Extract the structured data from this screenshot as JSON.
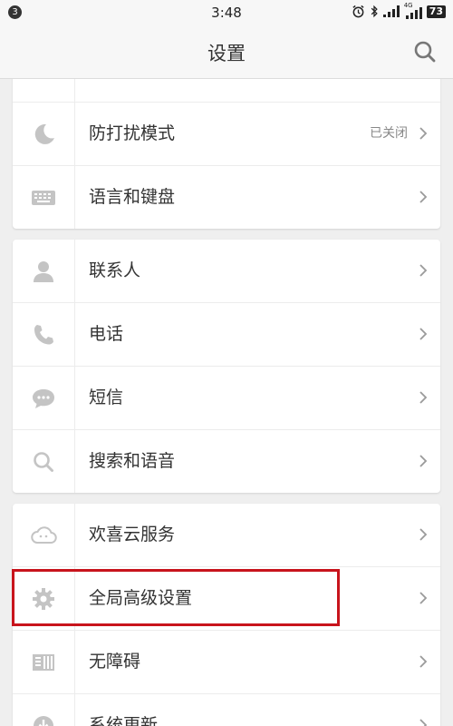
{
  "status_bar": {
    "notification_count": "3",
    "time": "3:48",
    "network": "4G",
    "battery": "73"
  },
  "header": {
    "title": "设置"
  },
  "groups": [
    {
      "items": [
        {
          "icon": "partial-icon",
          "label": "",
          "value": ""
        },
        {
          "icon": "moon-icon",
          "label": "防打扰模式",
          "value": "已关闭"
        },
        {
          "icon": "keyboard-icon",
          "label": "语言和键盘",
          "value": ""
        }
      ]
    },
    {
      "items": [
        {
          "icon": "contact-icon",
          "label": "联系人",
          "value": ""
        },
        {
          "icon": "phone-icon",
          "label": "电话",
          "value": ""
        },
        {
          "icon": "message-icon",
          "label": "短信",
          "value": ""
        },
        {
          "icon": "search-icon",
          "label": "搜索和语音",
          "value": ""
        }
      ]
    },
    {
      "items": [
        {
          "icon": "cloud-icon",
          "label": "欢喜云服务",
          "value": ""
        },
        {
          "icon": "gear-icon",
          "label": "全局高级设置",
          "value": ""
        },
        {
          "icon": "accessibility-icon",
          "label": "无障碍",
          "value": ""
        },
        {
          "icon": "update-icon",
          "label": "系统更新",
          "value": ""
        }
      ]
    }
  ],
  "colors": {
    "highlight_border": "#c8141c",
    "icon_gray": "#c4c4c4"
  }
}
